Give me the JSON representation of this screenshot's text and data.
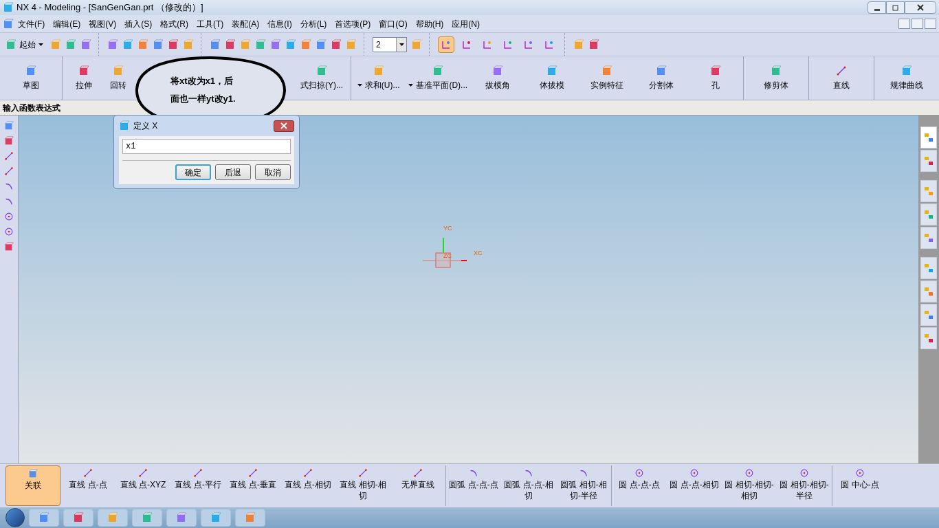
{
  "window": {
    "title": "NX 4 - Modeling - [SanGenGan.prt （修改的）]"
  },
  "menu": [
    "文件(F)",
    "编辑(E)",
    "视图(V)",
    "插入(S)",
    "格式(R)",
    "工具(T)",
    "装配(A)",
    "信息(I)",
    "分析(L)",
    "首选项(P)",
    "窗口(O)",
    "帮助(H)",
    "应用(N)"
  ],
  "toolbar": {
    "start": "起始",
    "layer": "2",
    "selection_tools": [
      {
        "selected": true
      },
      {
        "selected": false
      },
      {
        "selected": false
      },
      {
        "selected": false
      },
      {
        "selected": false
      },
      {
        "selected": false
      }
    ]
  },
  "feature_toolbar": [
    {
      "items": [
        {
          "label": "草图",
          "dropdown": false
        }
      ]
    },
    {
      "items": [
        {
          "label": "拉伸",
          "dropdown": false
        },
        {
          "label": "回转",
          "dropdown": false
        },
        {
          "label": "式扫掠(Y)...",
          "dropdown": false
        }
      ]
    },
    {
      "items": [
        {
          "label": "求和(U)...",
          "dropdown": true
        },
        {
          "label": "基准平面(D)...",
          "dropdown": true
        },
        {
          "label": "拔模角",
          "dropdown": false
        },
        {
          "label": "体拔模",
          "dropdown": false
        },
        {
          "label": "实例特征",
          "dropdown": false
        },
        {
          "label": "分割体",
          "dropdown": false
        },
        {
          "label": "孔",
          "dropdown": false
        }
      ]
    },
    {
      "items": [
        {
          "label": "修剪体",
          "dropdown": false
        }
      ]
    },
    {
      "items": [
        {
          "label": "直线",
          "dropdown": false
        }
      ]
    },
    {
      "items": [
        {
          "label": "规律曲线",
          "dropdown": false
        }
      ]
    }
  ],
  "prompt": "输入函数表达式",
  "callout": {
    "lines": [
      "将xt改为x1，后",
      "面也一样yt改y1."
    ]
  },
  "dialog": {
    "title": "定义 X",
    "value": "x1",
    "buttons": [
      {
        "label": "确定",
        "default": true
      },
      {
        "label": "后退",
        "default": false
      },
      {
        "label": "取消",
        "default": false
      }
    ]
  },
  "axes": {
    "y": "YC",
    "z": "ZC",
    "x": "XC"
  },
  "resource_bar": [
    {
      "selected": true
    },
    {
      "selected": false
    },
    {
      "selected": false
    },
    {
      "selected": false
    },
    {
      "selected": false
    },
    {
      "selected": false
    },
    {
      "selected": false
    },
    {
      "selected": false
    },
    {
      "selected": false
    }
  ],
  "curve_toolbar": [
    {
      "items": [
        {
          "label": "关联",
          "selected": true
        }
      ]
    },
    {
      "items": [
        {
          "label": "直线 点-点",
          "selected": false
        },
        {
          "label": "直线 点-XYZ",
          "selected": false
        },
        {
          "label": "直线 点-平行",
          "selected": false
        },
        {
          "label": "直线 点-垂直",
          "selected": false
        },
        {
          "label": "直线 点-相切",
          "selected": false
        },
        {
          "label": "直线 相切-相切",
          "selected": false
        },
        {
          "label": "无界直线",
          "selected": false
        }
      ]
    },
    {
      "items": [
        {
          "label": "圆弧 点-点-点",
          "selected": false
        },
        {
          "label": "圆弧 点-点-相切",
          "selected": false
        },
        {
          "label": "圆弧 相切-相切-半径",
          "selected": false
        }
      ]
    },
    {
      "items": [
        {
          "label": "圆 点-点-点",
          "selected": false
        },
        {
          "label": "圆 点-点-相切",
          "selected": false
        },
        {
          "label": "圆 相切-相切-相切",
          "selected": false
        },
        {
          "label": "圆 相切-相切-半径",
          "selected": false
        }
      ]
    },
    {
      "items": [
        {
          "label": "圆 中心-点",
          "selected": false
        }
      ]
    }
  ]
}
